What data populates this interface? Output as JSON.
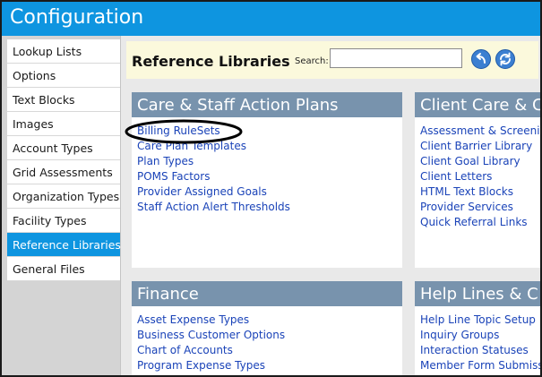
{
  "window": {
    "title": "Configuration"
  },
  "sidebar": {
    "items": [
      {
        "label": "Lookup Lists"
      },
      {
        "label": "Options"
      },
      {
        "label": "Text Blocks"
      },
      {
        "label": "Images"
      },
      {
        "label": "Account Types"
      },
      {
        "label": "Grid Assessments"
      },
      {
        "label": "Organization Types"
      },
      {
        "label": "Facility Types"
      },
      {
        "label": "Reference Libraries",
        "active": true
      },
      {
        "label": "General Files"
      }
    ]
  },
  "header": {
    "title": "Reference Libraries",
    "search_label": "Search:",
    "search_value": "",
    "back_icon": "undo-arrow-icon",
    "refresh_icon": "refresh-icon"
  },
  "panels": [
    {
      "title": "Care & Staff Action Plans",
      "links": [
        "Billing RuleSets",
        "Care Plan Templates",
        "Plan Types",
        "POMS Factors",
        "Provider Assigned Goals",
        "Staff Action Alert Thresholds"
      ]
    },
    {
      "title": "Client Care & C",
      "links": [
        "Assessment & Screening",
        "Client Barrier Library",
        "Client Goal Library",
        "Client Letters",
        "HTML Text Blocks",
        "Provider Services",
        "Quick Referral Links"
      ]
    },
    {
      "title": "Finance",
      "links": [
        "Asset Expense Types",
        "Business Customer Options",
        "Chart of Accounts",
        "Program Expense Types"
      ]
    },
    {
      "title": "Help Lines & C",
      "links": [
        "Help Line Topic Setup",
        "Inquiry Groups",
        "Interaction Statuses",
        "Member Form Submiss"
      ]
    }
  ],
  "colors": {
    "titlebar": "#0e95e0",
    "active_item": "#0e95e0",
    "panel_header": "#7893ad",
    "link": "#1a43b8",
    "header_band": "#fbf9dc"
  }
}
